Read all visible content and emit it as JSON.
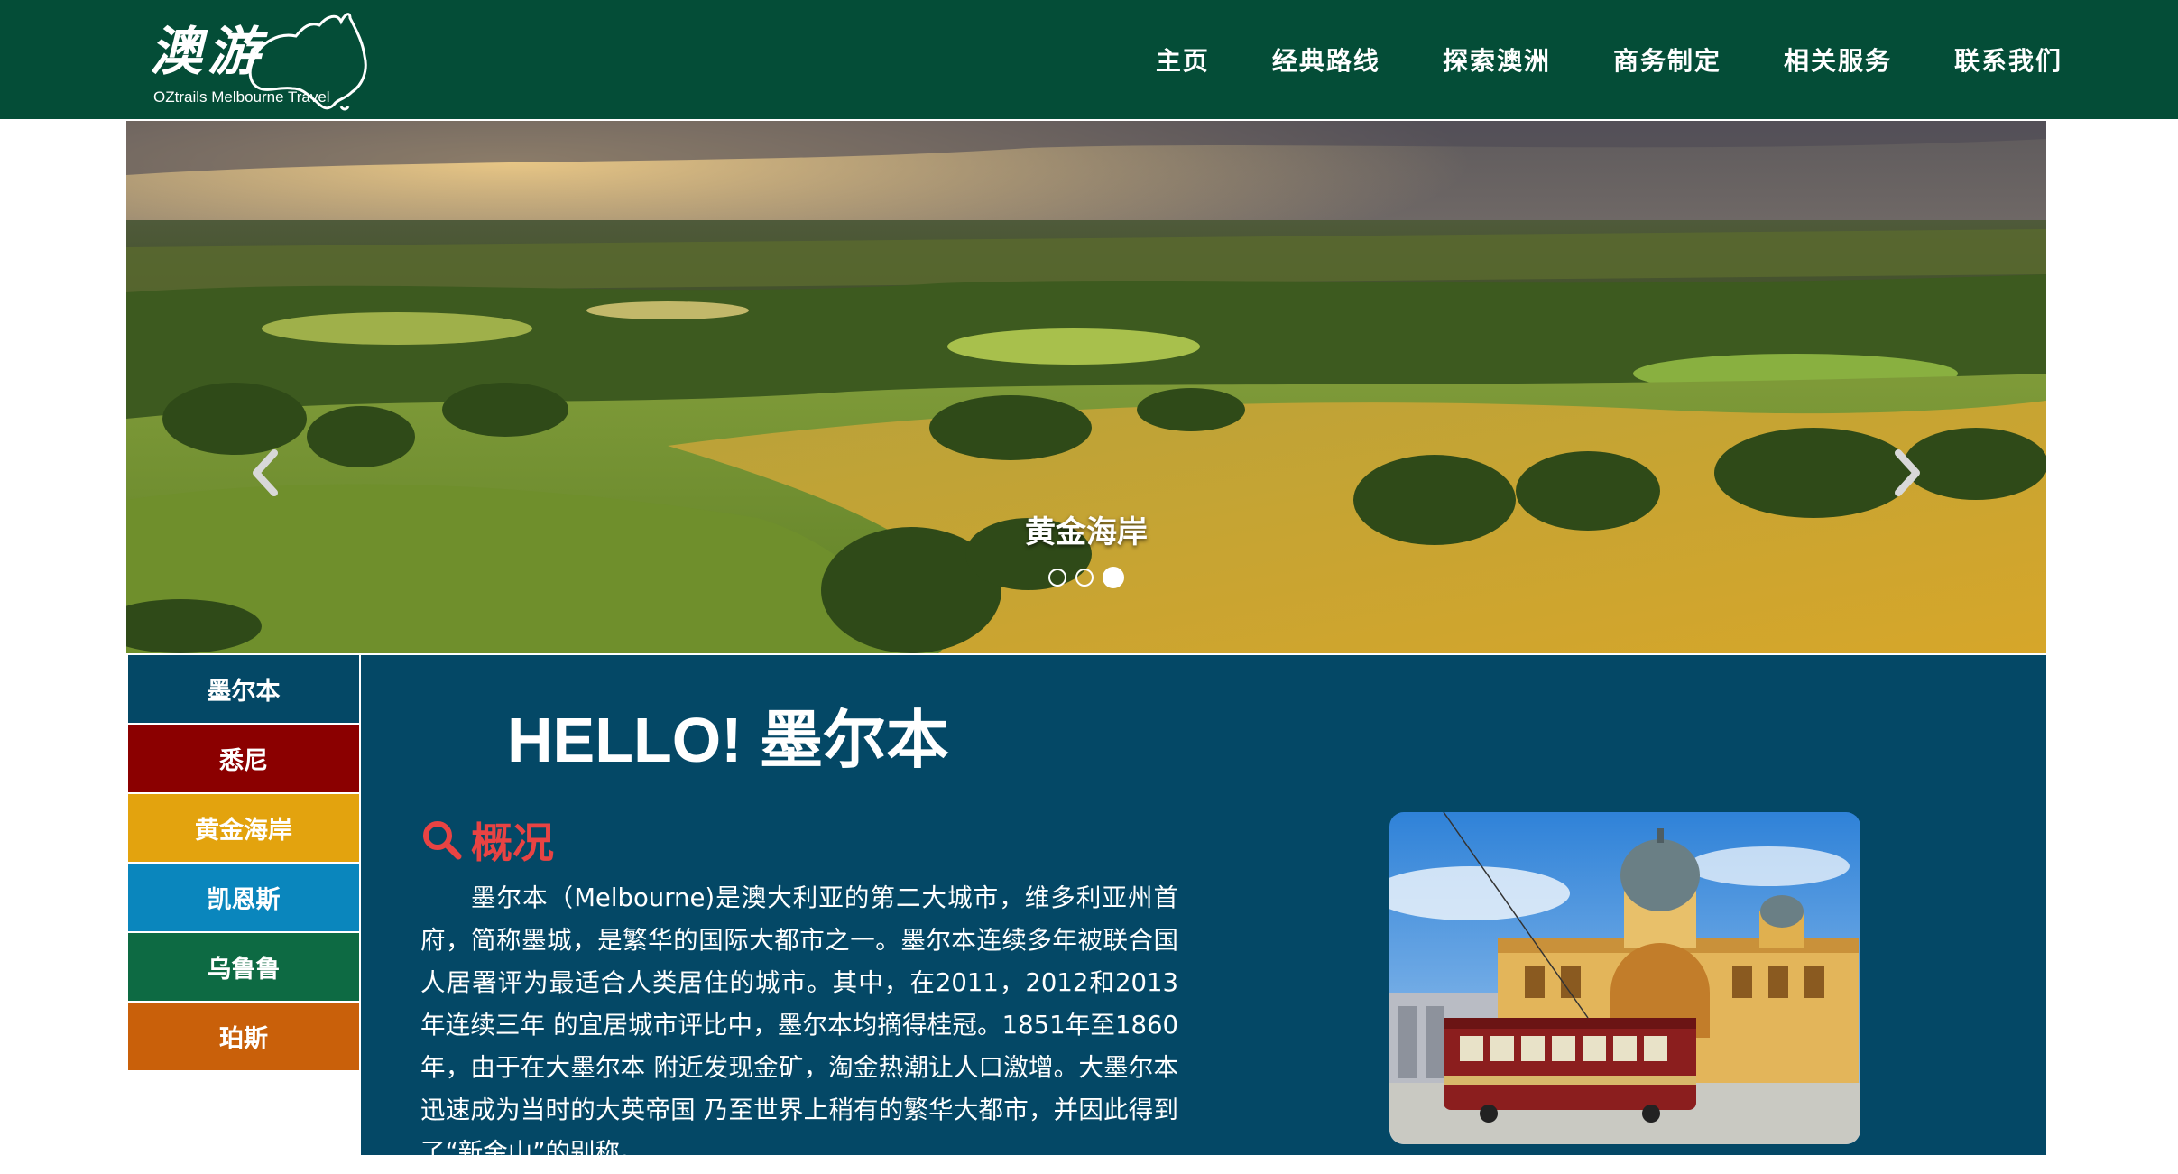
{
  "logo": {
    "cn": "澳游",
    "sub": "OZtrails Melbourne Travel"
  },
  "nav": {
    "items": [
      {
        "label": "主页"
      },
      {
        "label": "经典路线"
      },
      {
        "label": "探索澳洲"
      },
      {
        "label": "商务制定"
      },
      {
        "label": "相关服务"
      },
      {
        "label": "联系我们"
      }
    ]
  },
  "hero": {
    "caption": "黄金海岸",
    "slide_count": 3,
    "active_slide": 3
  },
  "sidebar": {
    "items": [
      {
        "label": "墨尔本",
        "color": "#044866"
      },
      {
        "label": "悉尼",
        "color": "#8b0000"
      },
      {
        "label": "黄金海岸",
        "color": "#e3a30e"
      },
      {
        "label": "凯恩斯",
        "color": "#0a86bd"
      },
      {
        "label": "乌鲁鲁",
        "color": "#0d6a43"
      },
      {
        "label": "珀斯",
        "color": "#c9600a"
      }
    ]
  },
  "main": {
    "title": "HELLO! 墨尔本",
    "section_label": "概况",
    "paragraph": "墨尔本（Melbourne)是澳大利亚的第二大城市，维多利亚州首府，简称墨城，是繁华的国际大都市之一。墨尔本连续多年被联合国人居署评为最适合人类居住的城市。其中，在2011，2012和2013年连续三年 的宜居城市评比中，墨尔本均摘得桂冠。1851年至1860年，由于在大墨尔本 附近发现金矿，淘金热潮让人口激增。大墨尔本迅速成为当时的大英帝国 乃至世界上稍有的繁华大都市，并因此得到了“新金山”的别称。"
  },
  "colors": {
    "header_bg": "#044d37",
    "main_bg": "#044866",
    "accent_red": "#e94343"
  }
}
